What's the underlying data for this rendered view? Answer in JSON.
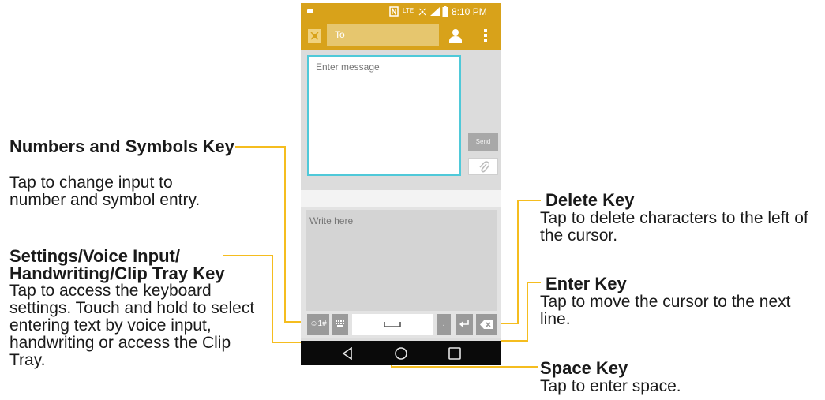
{
  "phone": {
    "status_time": "8:10 PM",
    "status_network": "LTE",
    "to_placeholder": "To",
    "message_placeholder": "Enter message",
    "send_label": "Send",
    "write_placeholder": "Write here",
    "symbols_key_label": "☺1#",
    "period_key_label": "."
  },
  "annotations": {
    "numbers_symbols": {
      "title": "Numbers and Symbols Key",
      "body": "Tap to change input to number and symbol entry."
    },
    "settings": {
      "title_line1": "Settings/Voice Input/",
      "title_line2": "Handwriting/Clip Tray Key",
      "body": "Tap to access the keyboard settings. Touch and hold to select entering text by voice input, handwriting or access the Clip Tray."
    },
    "delete": {
      "title": "Delete Key",
      "body": "Tap to delete characters to the left of the cursor."
    },
    "enter": {
      "title": "Enter Key",
      "body": "Tap to move the cursor to the next line."
    },
    "space": {
      "title": "Space Key",
      "body": "Tap to enter space."
    }
  },
  "colors": {
    "app_bar": "#d8a21a",
    "callout_line": "#f5bd1f",
    "message_border": "#4fc9d9"
  },
  "icons": [
    "contacts-icon",
    "more-vert-icon",
    "attachment-icon",
    "keyboard-icon",
    "enter-icon",
    "backspace-icon",
    "back-icon",
    "home-icon",
    "recents-icon",
    "nfc-icon",
    "signal-icon",
    "battery-icon"
  ]
}
